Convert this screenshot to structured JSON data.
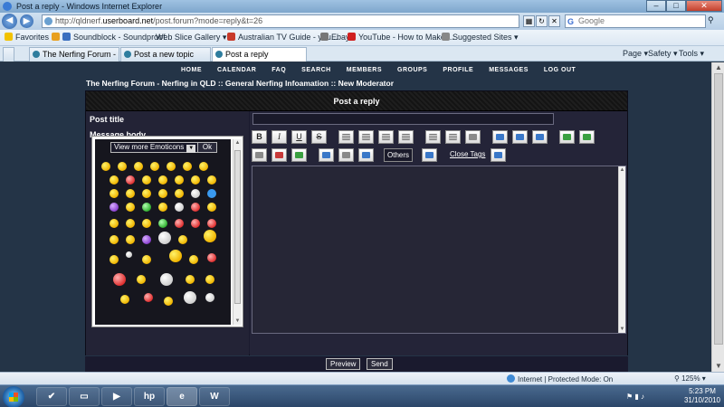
{
  "window": {
    "title": "Post a reply - Windows Internet Explorer"
  },
  "address": {
    "url_prefix": "http://qldnerf.",
    "url_domain": "userboard.net",
    "url_rest": "/post.forum?mode=reply&t=26",
    "search_placeholder": "Google"
  },
  "favorites": {
    "label": "Favorites",
    "items": [
      "Soundblock - Soundproof...",
      "Web Slice Gallery ▾",
      "Australian TV Guide - you...",
      "Ebay",
      "YouTube - How to Make ...",
      "Suggested Sites ▾"
    ]
  },
  "tabs": [
    "The Nerfing Forum - Nerfi...",
    "Post a new topic",
    "Post a reply"
  ],
  "commands": [
    "Page ▾",
    "Safety ▾",
    "Tools ▾"
  ],
  "forum": {
    "nav": [
      "HOME",
      "CALENDAR",
      "FAQ",
      "SEARCH",
      "MEMBERS",
      "GROUPS",
      "PROFILE",
      "MESSAGES",
      "LOG OUT"
    ],
    "breadcrumb": "The Nerfing Forum - Nerfing in QLD  :: General Nerfing Infoamation :: New Moderator",
    "panel_title": "Post a reply",
    "post_title_label": "Post title",
    "message_body_label": "Message body",
    "emoticons": {
      "view_more": "View more Emoticons",
      "ok": "Ok"
    },
    "toolbar": {
      "B": "B",
      "I": "I",
      "U": "U",
      "S": "S",
      "others": "Others",
      "close_tags": "Close Tags"
    },
    "preview": "Preview",
    "send": "Send"
  },
  "status": {
    "zone": "Internet | Protected Mode: On",
    "zoom": "125%"
  },
  "taskbar": {
    "time": "5:23 PM",
    "date": "31/10/2010"
  }
}
